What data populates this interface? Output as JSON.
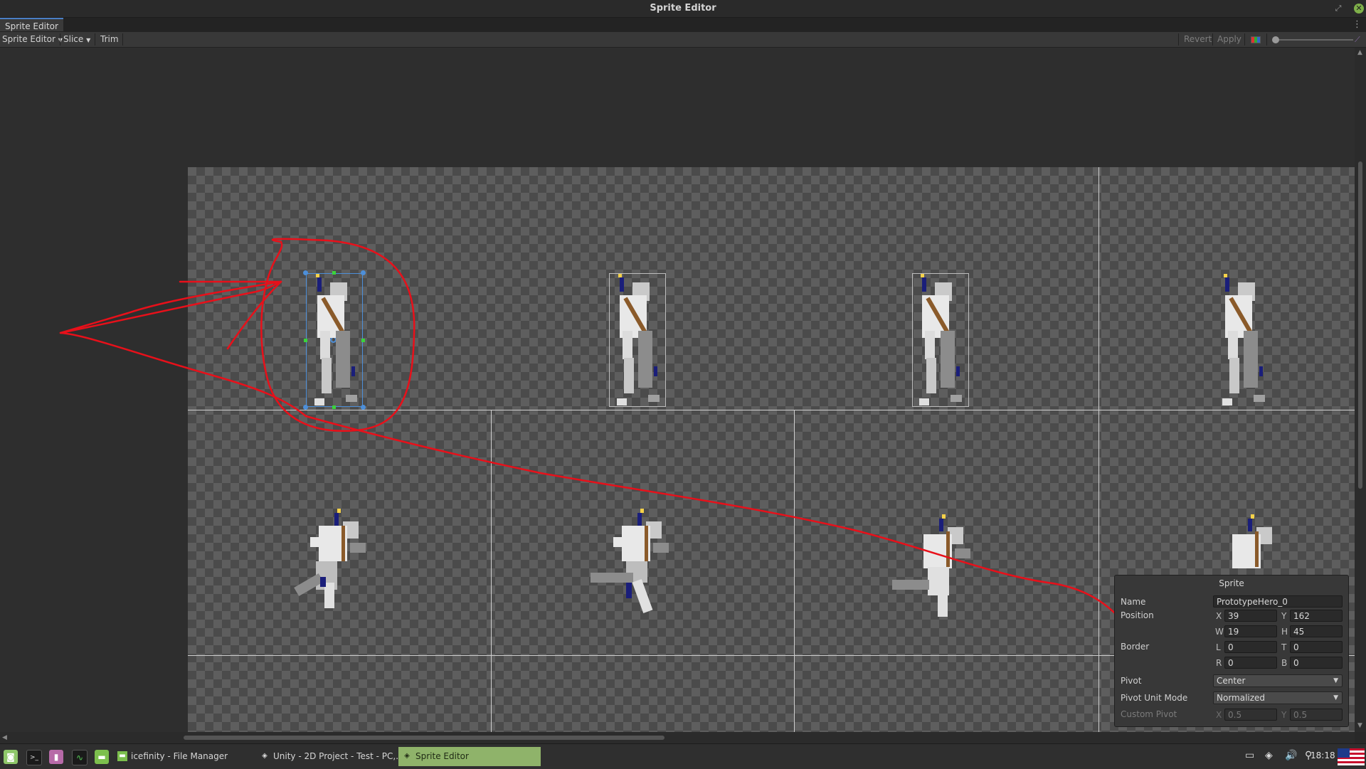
{
  "window": {
    "title": "Sprite Editor"
  },
  "tab": {
    "label": "Sprite Editor"
  },
  "toolbar": {
    "mode_dropdown": "Sprite Editor",
    "slice_dropdown": "Slice",
    "trim": "Trim",
    "revert": "Revert",
    "apply": "Apply"
  },
  "sprite_panel": {
    "title": "Sprite",
    "name_label": "Name",
    "name_value": "PrototypeHero_0",
    "position_label": "Position",
    "x_label": "X",
    "x_value": "39",
    "y_label": "Y",
    "y_value": "162",
    "w_label": "W",
    "w_value": "19",
    "h_label": "H",
    "h_value": "45",
    "border_label": "Border",
    "l_label": "L",
    "l_value": "0",
    "t_label": "T",
    "t_value": "0",
    "r_label": "R",
    "r_value": "0",
    "b_label": "B",
    "b_value": "0",
    "pivot_label": "Pivot",
    "pivot_value": "Center",
    "pivot_unit_label": "Pivot Unit Mode",
    "pivot_unit_value": "Normalized",
    "custom_pivot_label": "Custom Pivot",
    "custom_x_label": "X",
    "custom_x_value": "0.5",
    "custom_y_label": "Y",
    "custom_y_value": "0.5"
  },
  "taskbar": {
    "tasks": [
      {
        "label": "icefinity - File Manager"
      },
      {
        "label": "Unity - 2D Project - Test - PC,..."
      },
      {
        "label": "Sprite Editor"
      }
    ],
    "clock": "18:18"
  },
  "colors": {
    "annotation": "#e8101a",
    "selection": "#4d8fd9",
    "taskbar_active": "#8fb36a",
    "close_button": "#7fb04a"
  }
}
